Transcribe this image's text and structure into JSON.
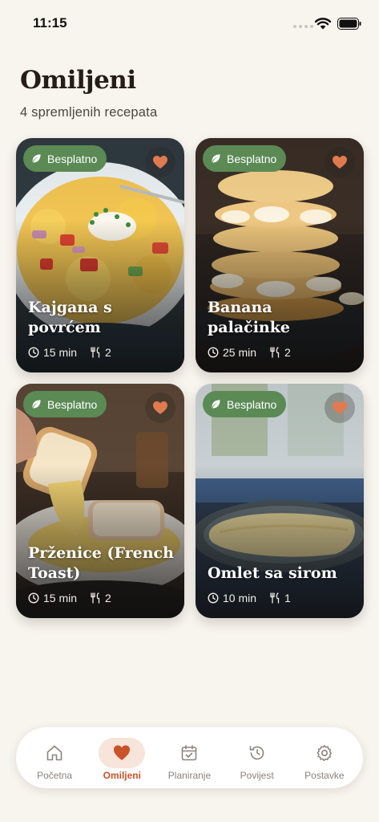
{
  "status": {
    "time": "11:15"
  },
  "header": {
    "title": "Omiljeni",
    "subtitle": "4 spremljenih recepata"
  },
  "colors": {
    "accent": "#c9532a",
    "badge": "#5b8a55",
    "heart": "#e07a4f",
    "background": "#f8f4ee"
  },
  "recipes": [
    {
      "badge": "Besplatno",
      "title": "Kajgana s povrćem",
      "time": "15 min",
      "servings": "2"
    },
    {
      "badge": "Besplatno",
      "title": "Banana palačinke",
      "time": "25 min",
      "servings": "2"
    },
    {
      "badge": "Besplatno",
      "title": "Prženice (French Toast)",
      "time": "15 min",
      "servings": "2"
    },
    {
      "badge": "Besplatno",
      "title": "Omlet sa sirom",
      "time": "10 min",
      "servings": "1"
    }
  ],
  "tabs": [
    {
      "label": "Početna",
      "icon": "home-icon"
    },
    {
      "label": "Omiljeni",
      "icon": "heart-icon",
      "active": true
    },
    {
      "label": "Planiranje",
      "icon": "calendar-check-icon"
    },
    {
      "label": "Povijest",
      "icon": "history-icon"
    },
    {
      "label": "Postavke",
      "icon": "gear-icon"
    }
  ]
}
